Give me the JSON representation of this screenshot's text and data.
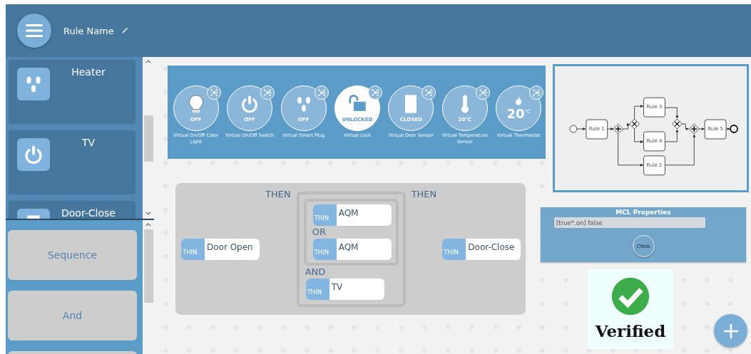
{
  "header": {
    "title": "Rule Name"
  },
  "device_list": {
    "items": [
      {
        "kind": "plug",
        "name": "Heater"
      },
      {
        "kind": "power",
        "name": "TV"
      },
      {
        "kind": "door",
        "name": "Door-Close"
      }
    ]
  },
  "operator_list": {
    "items": [
      {
        "kind": "button",
        "label": "Sequence"
      },
      {
        "kind": "button",
        "label": "And"
      },
      {
        "kind": "blank"
      }
    ]
  },
  "devices": [
    {
      "kind": "bulb",
      "state": "OFF",
      "name": "Virtual On/Off Color Light",
      "selected": false
    },
    {
      "kind": "power",
      "state": "OFF",
      "name": "Virtual On/Off Switch",
      "selected": false
    },
    {
      "kind": "plug",
      "state": "OFF",
      "name": "Virtual Smart Plug",
      "selected": false
    },
    {
      "kind": "lock",
      "state": "UNLOCKED",
      "name": "Virtual Lock",
      "selected": true
    },
    {
      "kind": "door",
      "state": "CLOSED",
      "name": "Virtual Door Sensor",
      "selected": false
    },
    {
      "kind": "thermometer",
      "state": "20°C",
      "name": "Virtual Temperature Sensor",
      "selected": false
    },
    {
      "kind": "thermostat",
      "state": "20$^{°C}$",
      "name": "Virtual Thermostat",
      "selected": false
    }
  ],
  "process_diagram": {
    "tasks": [
      "Rule 1",
      "Rule 3",
      "Rule 4",
      "Rule 2",
      "Rule 5"
    ]
  },
  "rule_canvas": {
    "sequence": [
      {
        "kind": "thing",
        "tag": "THIN",
        "name": "Door Open"
      },
      {
        "kind": "operator",
        "text": "THEN"
      },
      {
        "kind": "group",
        "children": [
          {
            "kind": "group",
            "children": [
              {
                "kind": "thing",
                "tag": "THIN",
                "name": "AQM"
              },
              {
                "kind": "operator",
                "text": "OR"
              },
              {
                "kind": "thing",
                "tag": "THIN",
                "name": "AQM"
              }
            ]
          },
          {
            "kind": "operator",
            "text": "AND"
          },
          {
            "kind": "thing",
            "tag": "THIN",
            "name": "TV"
          }
        ]
      },
      {
        "kind": "operator",
        "text": "THEN"
      },
      {
        "kind": "thing",
        "tag": "THIN",
        "name": "Door-Close"
      }
    ]
  },
  "mcl_properties": {
    "title": "MCL Properties",
    "value": "[true*.on] false",
    "button": "Check"
  },
  "verification": {
    "text": "Verified"
  }
}
